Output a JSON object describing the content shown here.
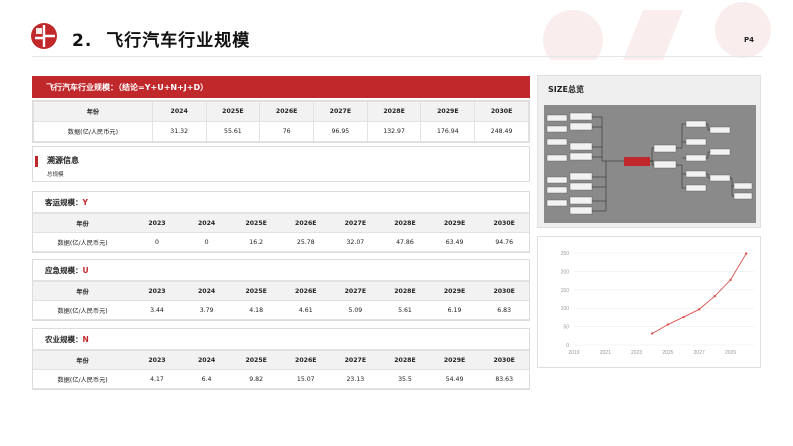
{
  "header": {
    "section_number": "2.",
    "title": "飞行汽车行业规模",
    "page_label": "P4"
  },
  "summary": {
    "banner": "飞行汽车行业规模：（结论=Y+U+N+J+D）",
    "header_row": [
      "年份",
      "2024",
      "2025E",
      "2026E",
      "2027E",
      "2028E",
      "2029E",
      "2030E"
    ],
    "data_row": [
      "数据(亿/人民币元)",
      "31.32",
      "55.61",
      "76",
      "96.95",
      "132.97",
      "176.94",
      "248.49"
    ]
  },
  "source": {
    "title": "溯源信息",
    "subtitle": "总规模"
  },
  "sections": [
    {
      "label": "客运规模：",
      "code": "Y",
      "header_row": [
        "年份",
        "2023",
        "2024",
        "2025E",
        "2026E",
        "2027E",
        "2028E",
        "2029E",
        "2030E"
      ],
      "data_row": [
        "数据(亿/人民币元)",
        "0",
        "0",
        "16.2",
        "25.78",
        "32.07",
        "47.86",
        "63.49",
        "94.76"
      ]
    },
    {
      "label": "应急规模：",
      "code": "U",
      "header_row": [
        "年份",
        "2023",
        "2024",
        "2025E",
        "2026E",
        "2027E",
        "2028E",
        "2029E",
        "2030E"
      ],
      "data_row": [
        "数据(亿/人民币元)",
        "3.44",
        "3.79",
        "4.18",
        "4.61",
        "5.09",
        "5.61",
        "6.19",
        "6.83"
      ]
    },
    {
      "label": "农业规模：",
      "code": "N",
      "header_row": [
        "年份",
        "2023",
        "2024",
        "2025E",
        "2026E",
        "2027E",
        "2028E",
        "2029E",
        "2030E"
      ],
      "data_row": [
        "数据(亿/人民币元)",
        "4.17",
        "6.4",
        "9.82",
        "15.07",
        "23.13",
        "35.5",
        "54.49",
        "83.63"
      ]
    }
  ],
  "size_panel": {
    "title": "SIZE总览"
  },
  "colors": {
    "accent": "#c0282b",
    "line": "#d9534f"
  },
  "chart_data": {
    "type": "line",
    "x": [
      2024,
      2025,
      2026,
      2027,
      2028,
      2029,
      2030
    ],
    "series": [
      {
        "values": [
          31.32,
          55.61,
          76,
          96.95,
          132.97,
          176.94,
          248.49
        ]
      }
    ],
    "xticks": [
      "2019",
      "2021",
      "2023",
      "2025",
      "2027",
      "2029"
    ],
    "yticks": [
      "0",
      "50",
      "100",
      "150",
      "200",
      "250"
    ],
    "xlim": [
      2019,
      2030.5
    ],
    "ylim": [
      0,
      250
    ],
    "grid": true
  }
}
